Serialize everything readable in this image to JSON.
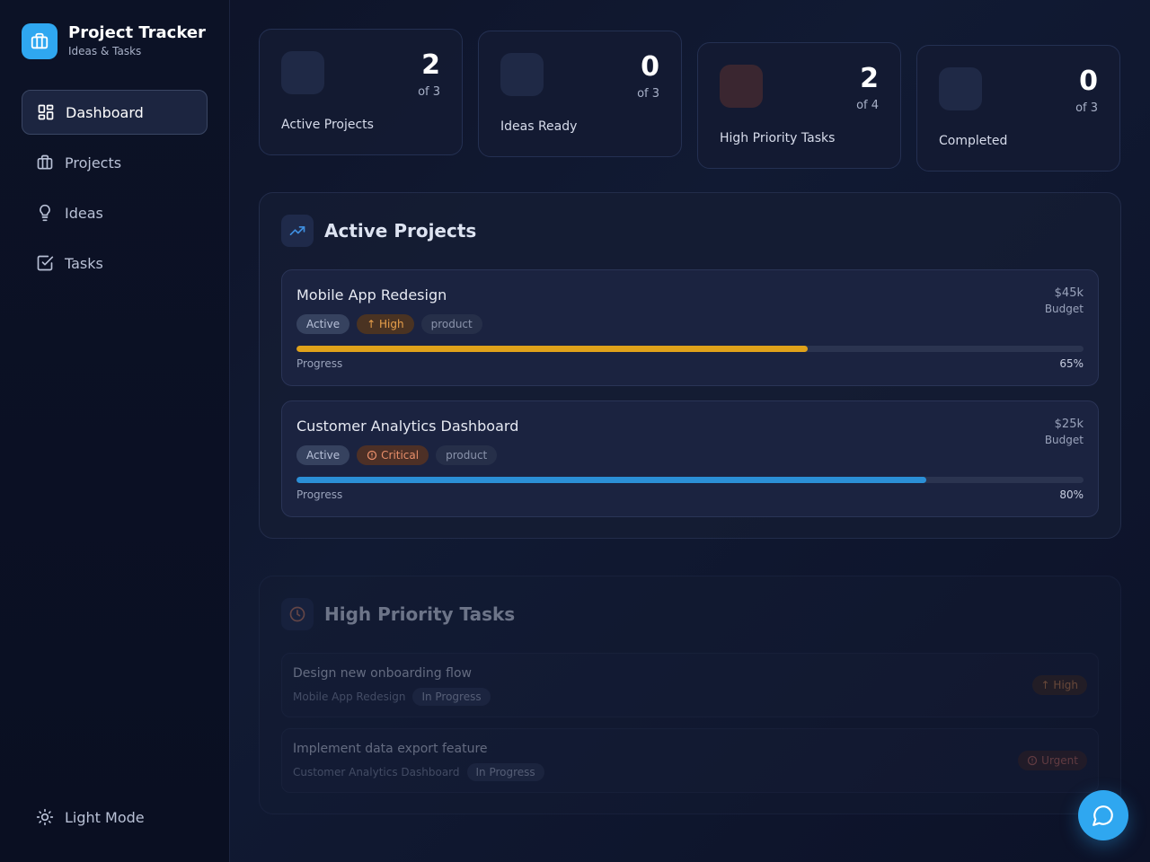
{
  "app": {
    "title": "Project Tracker",
    "subtitle": "Ideas & Tasks"
  },
  "sidebar": {
    "items": [
      {
        "label": "Dashboard",
        "icon": "dashboard-icon",
        "active": true
      },
      {
        "label": "Projects",
        "icon": "briefcase-icon",
        "active": false
      },
      {
        "label": "Ideas",
        "icon": "lightbulb-icon",
        "active": false
      },
      {
        "label": "Tasks",
        "icon": "checkbox-icon",
        "active": false
      }
    ],
    "theme_toggle": "Light Mode"
  },
  "stats": [
    {
      "value": "2",
      "of": "of 3",
      "label": "Active Projects",
      "color": "#1f2946"
    },
    {
      "value": "0",
      "of": "of 3",
      "label": "Ideas Ready",
      "color": "#1f2946"
    },
    {
      "value": "2",
      "of": "of 4",
      "label": "High Priority Tasks",
      "color": "#3a2630"
    },
    {
      "value": "0",
      "of": "of 3",
      "label": "Completed",
      "color": "#1f2946"
    }
  ],
  "active_projects": {
    "title": "Active Projects",
    "items": [
      {
        "name": "Mobile App Redesign",
        "budget": "$45k",
        "budget_label": "Budget",
        "status": "Active",
        "priority": "↑ High",
        "category": "product",
        "progress_label": "Progress",
        "progress_text": "65%",
        "progress": 0.65,
        "bar_color": "#e0a21a"
      },
      {
        "name": "Customer Analytics Dashboard",
        "budget": "$25k",
        "budget_label": "Budget",
        "status": "Active",
        "priority": "Critical",
        "category": "product",
        "progress_label": "Progress",
        "progress_text": "80%",
        "progress": 0.8,
        "bar_color": "#2b8fd6"
      }
    ]
  },
  "high_priority_tasks": {
    "title": "High Priority Tasks",
    "items": [
      {
        "name": "Design new onboarding flow",
        "project": "Mobile App Redesign",
        "status": "In Progress",
        "priority": "↑ High"
      },
      {
        "name": "Implement data export feature",
        "project": "Customer Analytics Dashboard",
        "status": "In Progress",
        "priority": "Urgent"
      }
    ]
  }
}
